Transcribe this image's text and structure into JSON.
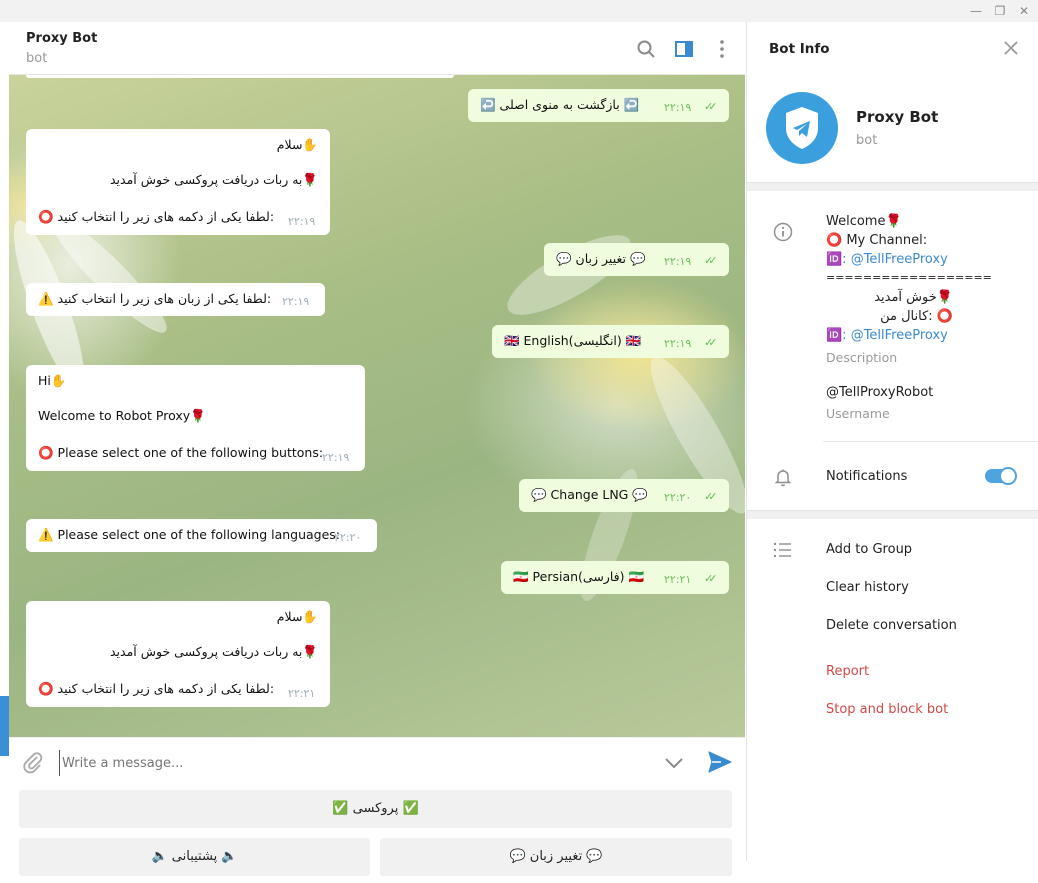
{
  "window": {
    "minimize": "—",
    "maximize": "❐",
    "close": "✕"
  },
  "header": {
    "title": "Proxy Bot",
    "subtitle": "bot"
  },
  "messages": [
    {
      "side": "out",
      "lines": [
        "↩️ بازگشت به منوی اصلی ↩️"
      ],
      "time": "۲۲:۱۹"
    },
    {
      "side": "in",
      "lines": [
        "سلام✋",
        "به ربات دریافت پروکسی خوش آمدید🌹",
        "⭕ لطفا یکی از دکمه های زیر را انتخاب کنید:"
      ],
      "time": "۲۲:۱۹"
    },
    {
      "side": "out",
      "lines": [
        "💬 تغییر زبان 💬"
      ],
      "time": "۲۲:۱۹"
    },
    {
      "side": "in",
      "lines": [
        "⚠️ لطفا یکی از زبان های زیر را انتخاب کنید:"
      ],
      "time": "۲۲:۱۹"
    },
    {
      "side": "out",
      "lines": [
        "🇬🇧 English(انگلیسی) 🇬🇧"
      ],
      "time": "۲۲:۱۹"
    },
    {
      "side": "in",
      "lines": [
        "Hi✋",
        "Welcome to Robot Proxy🌹",
        "⭕ Please select one of the following buttons:"
      ],
      "time": "۲۲:۱۹"
    },
    {
      "side": "out",
      "lines": [
        "💬 Change LNG 💬"
      ],
      "time": "۲۲:۲۰"
    },
    {
      "side": "in",
      "lines": [
        "⚠️ Please select one of the following languages:"
      ],
      "time": "۲۲:۲۰"
    },
    {
      "side": "out",
      "lines": [
        "🇮🇷 Persian(فارسی) 🇮🇷"
      ],
      "time": "۲۲:۲۱"
    },
    {
      "side": "in",
      "lines": [
        "سلام✋",
        "به ربات دریافت پروکسی خوش آمدید🌹",
        "⭕ لطفا یکی از دکمه های زیر را انتخاب کنید:"
      ],
      "time": "۲۲:۲۱"
    }
  ],
  "composer": {
    "placeholder": "Write a message..."
  },
  "keyboard": {
    "proxy": "✅ پروکسی ✅",
    "support": "🔈 پشتیبانی 🔈",
    "language": "💬 تغییر زبان 💬"
  },
  "panel": {
    "title": "Bot Info",
    "name": "Proxy Bot",
    "status": "bot",
    "description_lines": [
      "Welcome🌹",
      "⭕ My Channel:",
      "🆔: @TellFreeProxy",
      "==================",
      "خوش آمدید🌹",
      "کانال من: ⭕",
      "🆔: @TellFreeProxy"
    ],
    "description_label": "Description",
    "username": "@TellProxyRobot",
    "username_label": "Username",
    "notifications": "Notifications",
    "notifications_on": true,
    "actions": {
      "add_group": "Add to Group",
      "clear": "Clear history",
      "delete": "Delete conversation",
      "report": "Report",
      "block": "Stop and block bot"
    }
  },
  "colors": {
    "accent": "#3a8ad0",
    "outgoing": "#effdde",
    "danger": "#d24949"
  }
}
